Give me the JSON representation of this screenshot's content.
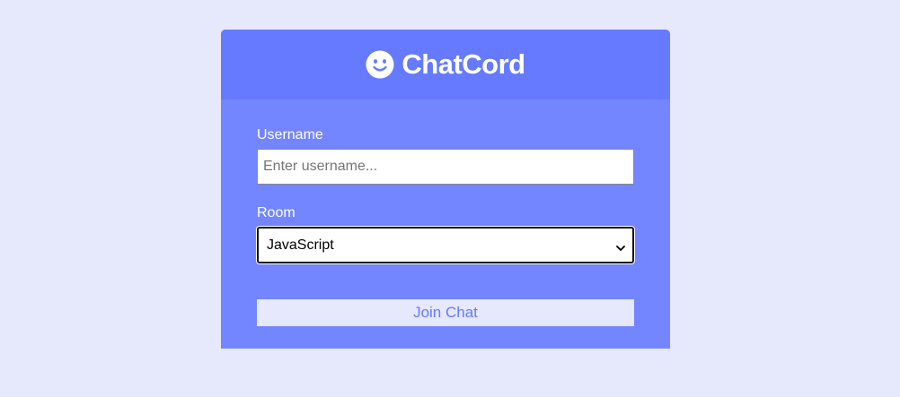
{
  "header": {
    "title": "ChatCord",
    "logo_icon": "smile-icon"
  },
  "form": {
    "username": {
      "label": "Username",
      "placeholder": "Enter username...",
      "value": ""
    },
    "room": {
      "label": "Room",
      "selected": "JavaScript",
      "icon": "chevron-down-icon"
    },
    "submit_label": "Join Chat"
  },
  "colors": {
    "page_background": "#e6e8fc",
    "header_background": "#667aff",
    "panel_background": "#7386ff",
    "button_text": "#667aff"
  }
}
